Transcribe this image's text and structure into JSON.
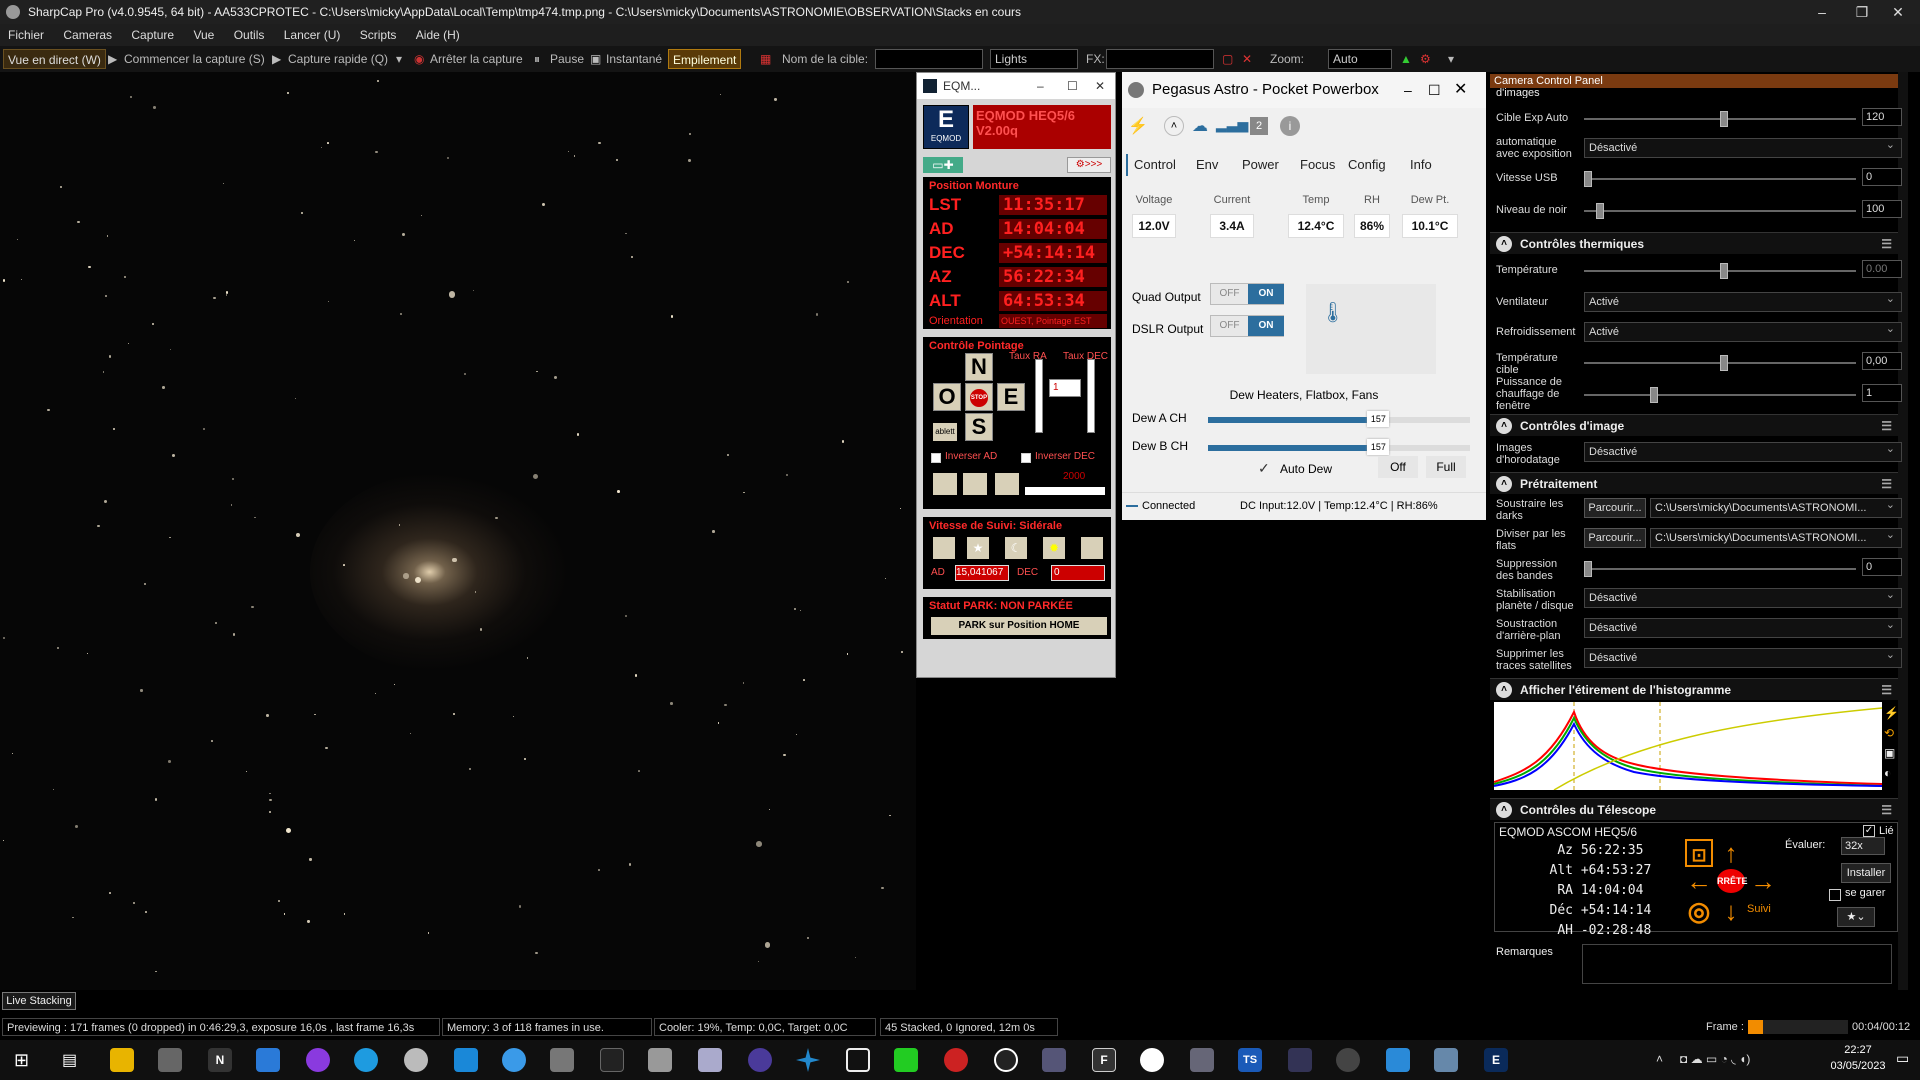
{
  "window": {
    "title": "SharpCap Pro (v4.0.9545, 64 bit) - AA533CPROTEC - C:\\Users\\micky\\AppData\\Local\\Temp\\tmp474.tmp.png - C:\\Users\\micky\\Documents\\ASTRONOMIE\\OBSERVATION\\Stacks en cours",
    "minimize": "–",
    "maximize": "❐",
    "close": "✕"
  },
  "menu": [
    "Fichier",
    "Cameras",
    "Capture",
    "Vue",
    "Outils",
    "Lancer (U)",
    "Scripts",
    "Aide (H)"
  ],
  "toolbar": {
    "live_view": "Vue en direct (W)",
    "start_capture": "Commencer la capture (S)",
    "quick_capture": "Capture rapide (Q)",
    "stop_capture": "Arrêter la capture",
    "pause": "Pause",
    "snapshot": "Instantané",
    "stacking": "Empilement",
    "target_label": "Nom de la cible:",
    "target_value": "",
    "frame_type": "Lights",
    "fx_label": "FX:",
    "fx_value": "",
    "zoom_label": "Zoom:",
    "zoom_value": "Auto"
  },
  "image": {
    "live_stacking": "Live Stacking"
  },
  "status": {
    "preview": "Previewing : 171 frames (0 dropped) in 0:46:29,3, exposure 16,0s , last frame 16,3s",
    "memory": "Memory: 3 of 118 frames in use.",
    "cooler": "Cooler: 19%, Temp: 0,0C, Target: 0,0C",
    "stacked": "45 Stacked, 0 Ignored, 12m 0s",
    "frame_label": "Frame :",
    "frame_time": "00:04/00:12",
    "frame_progress": 0.15
  },
  "eqmod": {
    "title": "EQM...",
    "logo_letter": "E",
    "logo_text": "EQMOD",
    "mount_name": "EQMOD HEQ5/6",
    "version": "V2.00q",
    "position_title": "Position Monture",
    "rows": [
      {
        "label": "LST",
        "value": "11:35:17"
      },
      {
        "label": "AD",
        "value": "14:04:04"
      },
      {
        "label": "DEC",
        "value": "+54:14:14"
      },
      {
        "label": "AZ",
        "value": "56:22:34"
      },
      {
        "label": "ALT",
        "value": "64:53:34"
      }
    ],
    "orientation_label": "Orientation",
    "orientation_value": "OUEST, Pointage EST",
    "slew_title": "Contrôle Pointage",
    "rate_ra": "Taux RA",
    "rate_dec": "Taux DEC",
    "rate_value": "1",
    "n": "N",
    "o": "O",
    "e": "E",
    "s": "S",
    "stop": "STOP",
    "tablet": "ablett",
    "invert_ad": "Inverser AD",
    "invert_dec": "Inverser DEC",
    "speed_value": "2000",
    "tracking_title": "Vitesse de Suivi: Sidérale",
    "ad_label": "AD",
    "ad_rate": "15,041067",
    "dec_label": "DEC",
    "dec_rate": "0",
    "park_status": "Statut PARK: NON PARKÉE",
    "park_button": "PARK sur Position HOME"
  },
  "pegasus": {
    "title": "Pegasus Astro - Pocket Powerbox",
    "badge": "2",
    "tabs": [
      "Control",
      "Env",
      "Power",
      "Focus",
      "Config",
      "Info"
    ],
    "readouts": [
      {
        "label": "Voltage",
        "value": "12.0V"
      },
      {
        "label": "Current",
        "value": "3.4A"
      },
      {
        "label": "Temp",
        "value": "12.4°C"
      },
      {
        "label": "RH",
        "value": "86%"
      },
      {
        "label": "Dew Pt.",
        "value": "10.1°C"
      }
    ],
    "quad_output": "Quad Output",
    "dslr_output": "DSLR Output",
    "off": "OFF",
    "on": "ON",
    "dew_title": "Dew Heaters, Flatbox, Fans",
    "dew_a": "Dew A CH",
    "dew_b": "Dew B CH",
    "dew_a_value": "157",
    "dew_b_value": "157",
    "dew_a_level": 0.616,
    "dew_b_level": 0.616,
    "auto_dew": "Auto Dew",
    "off_button": "Off",
    "full_button": "Full",
    "connected": "Connected",
    "status_line": "DC Input:12.0V | Temp:12.4°C | RH:86%"
  },
  "camera_panel": {
    "title": "Camera Control Panel",
    "clipped_label": "d'images",
    "auto_exp_target": "Cible Exp Auto",
    "auto_exp_value": "120",
    "auto_exposure": "automatique avec exposition",
    "disabled": "Désactivé",
    "usb_speed": "Vitesse USB",
    "usb_value": "0",
    "black_level": "Niveau de noir",
    "black_value": "100",
    "thermal_title": "Contrôles thermiques",
    "temperature": "Température",
    "temperature_value": "0.00",
    "fan": "Ventilateur",
    "enabled": "Activé",
    "cooling": "Refroidissement",
    "target_temp": "Température cible",
    "target_temp_value": "0,00",
    "heater_power": "Puissance de chauffage de fenêtre",
    "heater_value": "1",
    "image_title": "Contrôles d'image",
    "timestamp": "Images d'horodatage",
    "preprocess_title": "Prétraitement",
    "sub_darks": "Soustraire les darks",
    "div_flats": "Diviser par les flats",
    "browse": "Parcourir...",
    "path": "C:\\Users\\micky\\Documents\\ASTRONOMI...",
    "banding": "Suppression des bandes",
    "banding_value": "0",
    "stabilize": "Stabilisation planète / disque",
    "bg_sub": "Soustraction d'arrière-plan",
    "satellite": "Supprimer les traces satellites",
    "histogram_title": "Afficher l'étirement de l'histogramme",
    "scope_title": "Contrôles du Télescope",
    "scope_name": "EQMOD ASCOM HEQ5/6",
    "linked": "Lié",
    "scope_rows": [
      {
        "label": "Az",
        "value": "56:22:35"
      },
      {
        "label": "Alt",
        "value": "+64:53:27"
      },
      {
        "label": "RA",
        "value": "14:04:04"
      },
      {
        "label": "Déc",
        "value": "+54:14:14"
      },
      {
        "label": "AH",
        "value": "-02:28:48"
      }
    ],
    "stop": "RRÊTE",
    "evaluate": "Évaluer:",
    "evaluate_value": "32x",
    "install": "Installer",
    "park": "se garer",
    "track": "Suivi",
    "remarks": "Remarques"
  },
  "taskbar": {
    "time": "22:27",
    "date": "03/05/2023"
  },
  "colors": {
    "accent": "#2c6e9e",
    "eqmod_red": "#ff2020",
    "scope_orange": "#f28c00"
  }
}
